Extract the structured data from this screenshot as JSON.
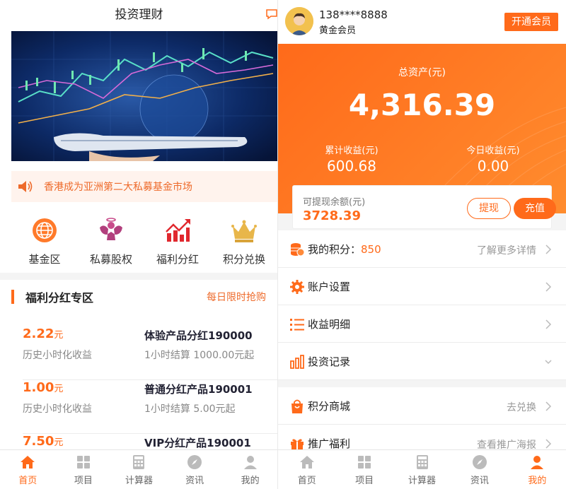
{
  "left": {
    "title": "投资理财",
    "notice": "香港成为亚洲第二大私募基金市场",
    "categories": [
      {
        "label": "基金区",
        "icon": "globe-icon"
      },
      {
        "label": "私募股权",
        "icon": "angel-icon"
      },
      {
        "label": "福利分红",
        "icon": "trend-chart-icon"
      },
      {
        "label": "积分兑换",
        "icon": "crown-icon"
      }
    ],
    "zone": {
      "title": "福利分红专区",
      "more": "每日限时抢购",
      "products": [
        {
          "rate": "2.22",
          "unit": "元",
          "rate_label": "历史小时化收益",
          "name": "体验产品分红190000",
          "desc": "1小时结算 1000.00元起"
        },
        {
          "rate": "1.00",
          "unit": "元",
          "rate_label": "历史小时化收益",
          "name": "普通分红产品190001",
          "desc": "1小时结算 5.00元起"
        },
        {
          "rate": "7.50",
          "unit": "元",
          "rate_label": "",
          "name": "VIP分红产品190001",
          "desc": ""
        }
      ]
    }
  },
  "tabs": [
    {
      "label": "首页",
      "icon": "home-icon"
    },
    {
      "label": "项目",
      "icon": "grid-icon"
    },
    {
      "label": "计算器",
      "icon": "calculator-icon"
    },
    {
      "label": "资讯",
      "icon": "compass-icon"
    },
    {
      "label": "我的",
      "icon": "user-icon"
    }
  ],
  "right": {
    "phone": "138****8888",
    "level": "黄金会员",
    "vip_button": "开通会员",
    "total_label": "总资产(元)",
    "total_value": "4,316.39",
    "cumulative_label": "累计收益(元)",
    "cumulative_value": "600.68",
    "today_label": "今日收益(元)",
    "today_value": "0.00",
    "withdraw_label": "可提现余额(元)",
    "withdraw_value": "3728.39",
    "withdraw_button": "提现",
    "recharge_button": "充值",
    "menu1": [
      {
        "label": "我的积分：",
        "points": "850",
        "right": "了解更多详情",
        "icon": "coins-icon"
      },
      {
        "label": "账户设置",
        "points": "",
        "right": "",
        "icon": "gear-icon"
      },
      {
        "label": "收益明细",
        "points": "",
        "right": "",
        "icon": "list-icon"
      },
      {
        "label": "投资记录",
        "points": "",
        "right": "",
        "icon": "bar-chart-icon"
      }
    ],
    "menu2": [
      {
        "label": "积分商城",
        "right": "去兑换",
        "icon": "shopping-bag-icon"
      },
      {
        "label": "推广福利",
        "right": "查看推广海报",
        "icon": "gift-icon"
      }
    ]
  },
  "colors": {
    "accent": "#ff6a1a",
    "notice_bg": "#fff3ed",
    "tab_inactive": "#666666"
  }
}
